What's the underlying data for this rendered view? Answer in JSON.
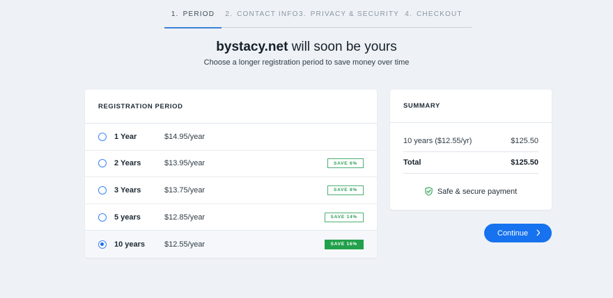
{
  "stepper": {
    "steps": [
      {
        "num": "1.",
        "label": "PERIOD"
      },
      {
        "num": "2.",
        "label": "CONTACT INFO"
      },
      {
        "num": "3.",
        "label": "PRIVACY & SECURITY"
      },
      {
        "num": "4.",
        "label": "CHECKOUT"
      }
    ]
  },
  "headline": {
    "domain": "bystacy.net",
    "rest": " will soon be yours",
    "subtitle": "Choose a longer registration period to save money over time"
  },
  "registration": {
    "title": "REGISTRATION PERIOD",
    "options": [
      {
        "label": "1 Year",
        "price": "$14.95/year",
        "badge": ""
      },
      {
        "label": "2 Years",
        "price": "$13.95/year",
        "badge": "SAVE 6%"
      },
      {
        "label": "3 Years",
        "price": "$13.75/year",
        "badge": "SAVE 8%"
      },
      {
        "label": "5 years",
        "price": "$12.85/year",
        "badge": "SAVE 14%"
      },
      {
        "label": "10 years",
        "price": "$12.55/year",
        "badge": "SAVE 16%"
      }
    ],
    "selected_index": 4
  },
  "summary": {
    "title": "SUMMARY",
    "item_label": "10 years ($12.55/yr)",
    "item_value": "$125.50",
    "total_label": "Total",
    "total_value": "$125.50",
    "secure_text": "Safe & secure payment"
  },
  "actions": {
    "continue_label": "Continue"
  },
  "colors": {
    "accent": "#1672ee",
    "save_badge": "#22a04b",
    "background": "#eef1f5"
  }
}
